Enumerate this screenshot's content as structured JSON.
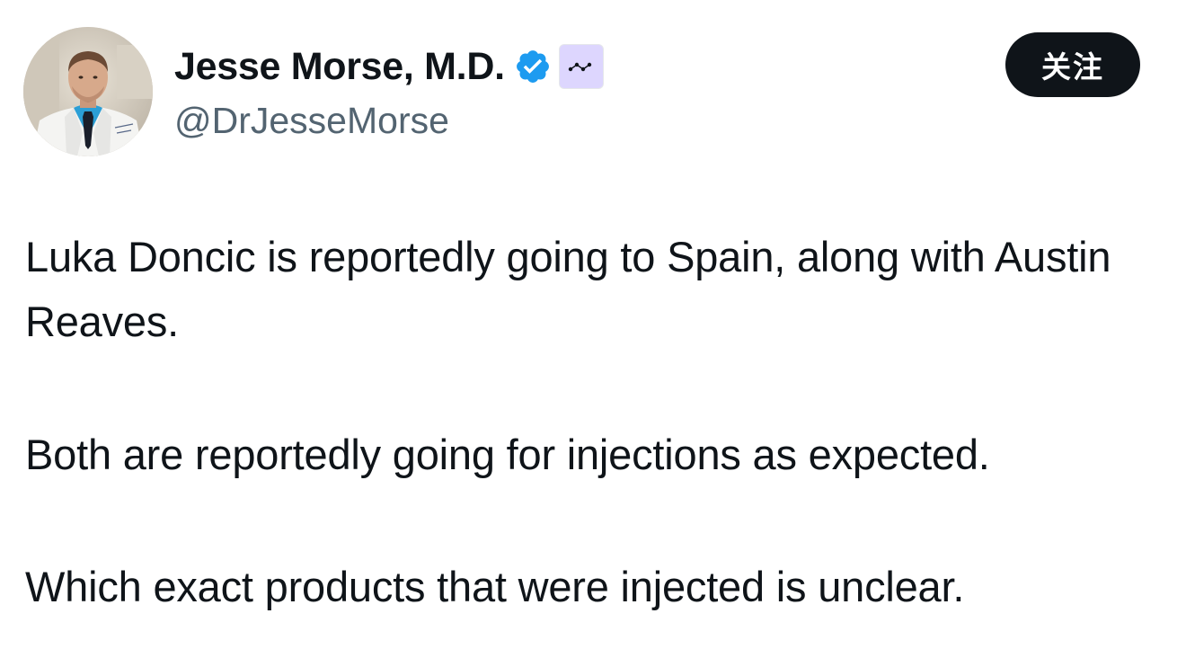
{
  "author": {
    "display_name": "Jesse Morse, M.D.",
    "handle": "@DrJesseMorse",
    "avatar_icon": "profile-photo",
    "verified_icon": "verified-badge-icon",
    "verified_color": "#1d9bf0",
    "affiliate_badge_icon": "affiliate-badge-icon",
    "affiliate_badge_color": "#ddd6fe"
  },
  "follow_button": {
    "label": "关注",
    "background": "#0f1419",
    "text_color": "#ffffff"
  },
  "tweet": {
    "paragraphs": [
      "Luka Doncic is reportedly going to Spain, along with Austin Reaves.",
      "Both are reportedly going for injections as expected.",
      "Which exact products that were injected is unclear."
    ]
  }
}
